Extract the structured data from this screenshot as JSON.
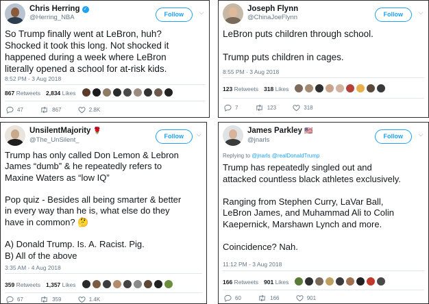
{
  "tweets": [
    {
      "name": "Chris Herring",
      "handle": "@Herring_NBA",
      "follow_label": "Follow",
      "text": "So Trump finally went at LeBron, huh?\nShocked it took this long. Not shocked it\nhappened during a week where LeBron\nliterally opened a school for at-risk kids.",
      "timestamp": "8:52 PM - 3 Aug 2018",
      "retweets": "867",
      "retweets_label": "Retweets",
      "likes": "2,834",
      "likes_label": "Likes",
      "reply_count": "47",
      "retweet_count": "867",
      "like_count": "2.8K"
    },
    {
      "name": "Joseph Flynn",
      "handle": "@ChinaJoeFlynn",
      "follow_label": "Follow",
      "text": "LeBron puts children through school.\n\nTrump puts children in cages.",
      "timestamp": "8:55 PM - 3 Aug 2018",
      "retweets": "123",
      "retweets_label": "Retweets",
      "likes": "318",
      "likes_label": "Likes",
      "reply_count": "7",
      "retweet_count": "123",
      "like_count": "318"
    },
    {
      "name": "UnsilentMajority",
      "name_emoji": "🌹",
      "handle": "@The_UnSilent_",
      "follow_label": "Follow",
      "text": "Trump has only called Don Lemon & Lebron\nJames “dumb” & he repeatedly refers to\nMaxine Waters as “low IQ”\n\nPop quiz - Besides all being smarter & better\nin every way than he is, what else do they\nhave in common? 🤔\n\nA) Donald Trump. Is. A. Racist. Pig.\nB) All of the above",
      "timestamp": "3:35 AM - 4 Aug 2018",
      "retweets": "359",
      "retweets_label": "Retweets",
      "likes": "1,357",
      "likes_label": "Likes",
      "reply_count": "67",
      "retweet_count": "359",
      "like_count": "1.4K"
    },
    {
      "name": "James Parkley",
      "name_emoji": "🇺🇸",
      "handle": "@jnarls",
      "follow_label": "Follow",
      "replying_prefix": "Replying to",
      "replying_to": "@jnarls @realDonaldTrump",
      "text": "Trump has repeatedly singled out and\nattacked countless black athletes exclusively.\n\nRanging from Stephen Curry, LaVar Ball,\nLeBron James, and Muhammad Ali to Colin\nKaepernick, Marshawn Lynch and more.\n\nCoincidence? Nah.",
      "timestamp": "11:12 PM - 3 Aug 2018",
      "retweets": "166",
      "retweets_label": "Retweets",
      "likes": "901",
      "likes_label": "Likes",
      "reply_count": "60",
      "retweet_count": "166",
      "like_count": "901"
    }
  ],
  "colors": {
    "accent": "#1da1f2",
    "secondary_text": "#657786",
    "primary_text": "#14171a"
  }
}
